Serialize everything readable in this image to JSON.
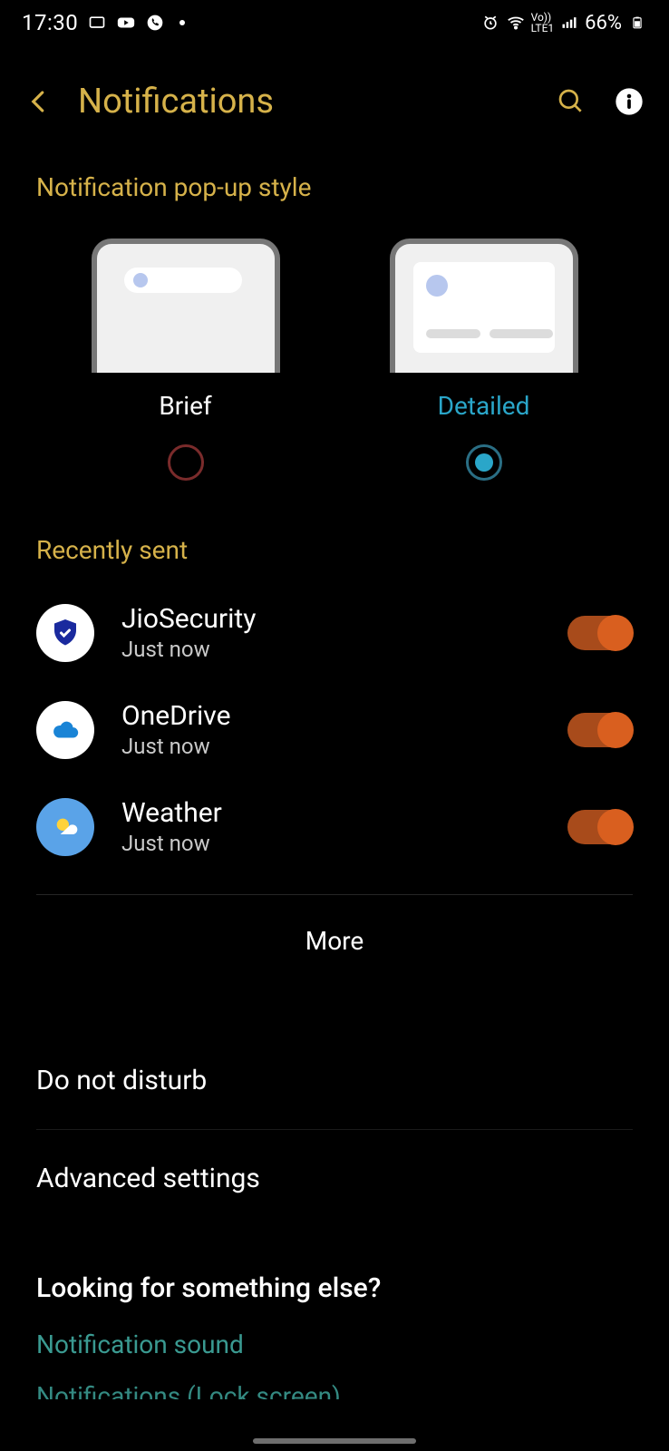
{
  "status": {
    "time": "17:30",
    "battery": "66%"
  },
  "header": {
    "title": "Notifications"
  },
  "popup": {
    "section_title": "Notification pop-up style",
    "options": [
      {
        "label": "Brief",
        "selected": false
      },
      {
        "label": "Detailed",
        "selected": true
      }
    ]
  },
  "recent": {
    "section_title": "Recently sent",
    "apps": [
      {
        "name": "JioSecurity",
        "time": "Just now",
        "enabled": true,
        "icon": "shield"
      },
      {
        "name": "OneDrive",
        "time": "Just now",
        "enabled": true,
        "icon": "cloud"
      },
      {
        "name": "Weather",
        "time": "Just now",
        "enabled": true,
        "icon": "sun"
      }
    ],
    "more_label": "More"
  },
  "items": {
    "dnd": "Do not disturb",
    "advanced": "Advanced settings"
  },
  "lfse": {
    "title": "Looking for something else?",
    "link1": "Notification sound",
    "link2_partial": "Notifications (Lock screen)"
  }
}
